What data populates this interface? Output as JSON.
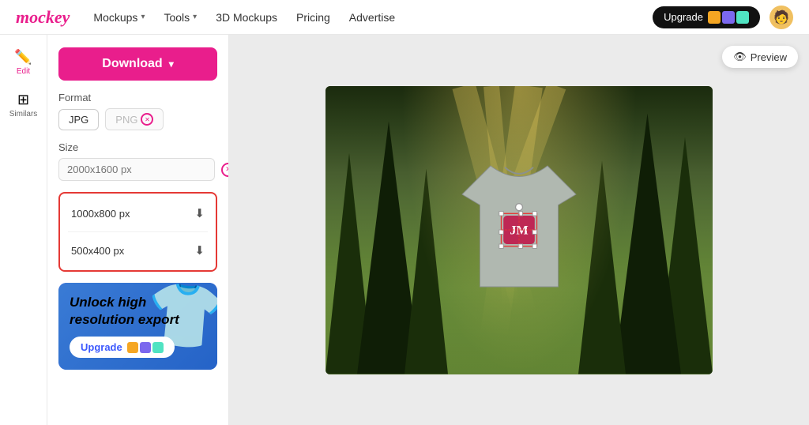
{
  "app": {
    "logo": "mockey",
    "nav": {
      "items": [
        {
          "label": "Mockups",
          "has_dropdown": true
        },
        {
          "label": "Tools",
          "has_dropdown": true
        },
        {
          "label": "3D Mockups",
          "has_dropdown": false
        },
        {
          "label": "Pricing",
          "has_dropdown": false
        },
        {
          "label": "Advertise",
          "has_dropdown": false
        }
      ],
      "upgrade_label": "Upgrade",
      "upgrade_icon_colors": [
        "#f5a623",
        "#7b68ee",
        "#50e3c2"
      ]
    }
  },
  "sidebar": {
    "icons": [
      {
        "id": "edit",
        "symbol": "✏️",
        "label": "Edit",
        "active": true
      },
      {
        "id": "similars",
        "symbol": "⊞",
        "label": "Similars",
        "active": false
      }
    ]
  },
  "panel": {
    "download_label": "Download",
    "format_section_label": "Format",
    "format_options": [
      {
        "label": "JPG",
        "active": true,
        "locked": false
      },
      {
        "label": "PNG",
        "active": false,
        "locked": true
      }
    ],
    "size_section_label": "Size",
    "size_placeholder": "2000x1600 px",
    "size_options": [
      {
        "label": "1000x800 px"
      },
      {
        "label": "500x400 px"
      }
    ],
    "upgrade_card": {
      "title": "Unlock high resolution export",
      "button_label": "Upgrade"
    }
  },
  "canvas": {
    "preview_label": "Preview",
    "preview_icon": "👁"
  }
}
